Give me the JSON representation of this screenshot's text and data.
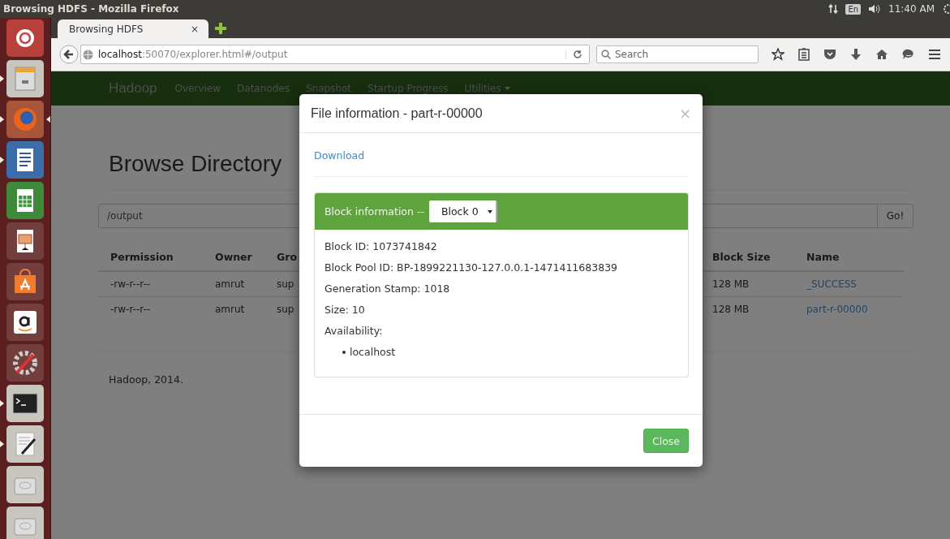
{
  "top_bar": {
    "window_title": "Browsing HDFS - Mozilla Firefox",
    "keyboard_layout": "En",
    "clock": "11:40 AM"
  },
  "launcher": {
    "items": [
      {
        "kind": "ubuntu",
        "running": false,
        "selected": false
      },
      {
        "kind": "files",
        "running": true,
        "selected": false
      },
      {
        "kind": "firefox",
        "running": true,
        "selected": true
      },
      {
        "kind": "writer",
        "running": true,
        "selected": false
      },
      {
        "kind": "calc",
        "running": false,
        "selected": false
      },
      {
        "kind": "impress",
        "running": false,
        "selected": false
      },
      {
        "kind": "software",
        "running": false,
        "selected": false
      },
      {
        "kind": "amazon",
        "running": false,
        "selected": false
      },
      {
        "kind": "settings",
        "running": false,
        "selected": false
      },
      {
        "kind": "terminal",
        "running": true,
        "selected": false
      },
      {
        "kind": "editor",
        "running": true,
        "selected": false
      },
      {
        "kind": "disk",
        "running": false,
        "selected": false
      },
      {
        "kind": "disk",
        "running": false,
        "selected": false
      }
    ]
  },
  "browser": {
    "tabs": [
      {
        "label": "Browsing HDFS",
        "close": "×",
        "selected": true
      }
    ],
    "url": {
      "host": "localhost",
      "rest": ":50070/explorer.html#/output"
    },
    "search": {
      "placeholder": "Search"
    }
  },
  "site_nav": {
    "brand": "Hadoop",
    "items": [
      {
        "label": "Overview",
        "dropdown": false
      },
      {
        "label": "Datanodes",
        "dropdown": false
      },
      {
        "label": "Snapshot",
        "dropdown": false
      },
      {
        "label": "Startup Progress",
        "dropdown": false
      },
      {
        "label": "Utilities",
        "dropdown": true
      }
    ]
  },
  "page": {
    "heading": "Browse Directory",
    "path_field": {
      "value": "/output"
    },
    "go_button": "Go!",
    "table": {
      "columns": [
        "Permission",
        "Owner",
        "Gro",
        "Block Size",
        "Name"
      ],
      "rows": [
        [
          "-rw-r--r--",
          "amrut",
          "sup",
          "128 MB",
          "_SUCCESS"
        ],
        [
          "-rw-r--r--",
          "amrut",
          "sup",
          "128 MB",
          "part-r-00000"
        ]
      ]
    },
    "footer": "Hadoop, 2014."
  },
  "modal": {
    "title": "File information - part-r-00000",
    "close_icon": "×",
    "download_link": "Download",
    "panel_heading": "Block information --",
    "block_select": "Block 0",
    "lines": [
      "Block ID: 1073741842",
      "Block Pool ID: BP-1899221130-127.0.0.1-1471411683839",
      "Generation Stamp: 1018",
      "Size: 10"
    ],
    "availability_label": "Availability:",
    "hosts": [
      "localhost"
    ],
    "close_button": "Close"
  }
}
